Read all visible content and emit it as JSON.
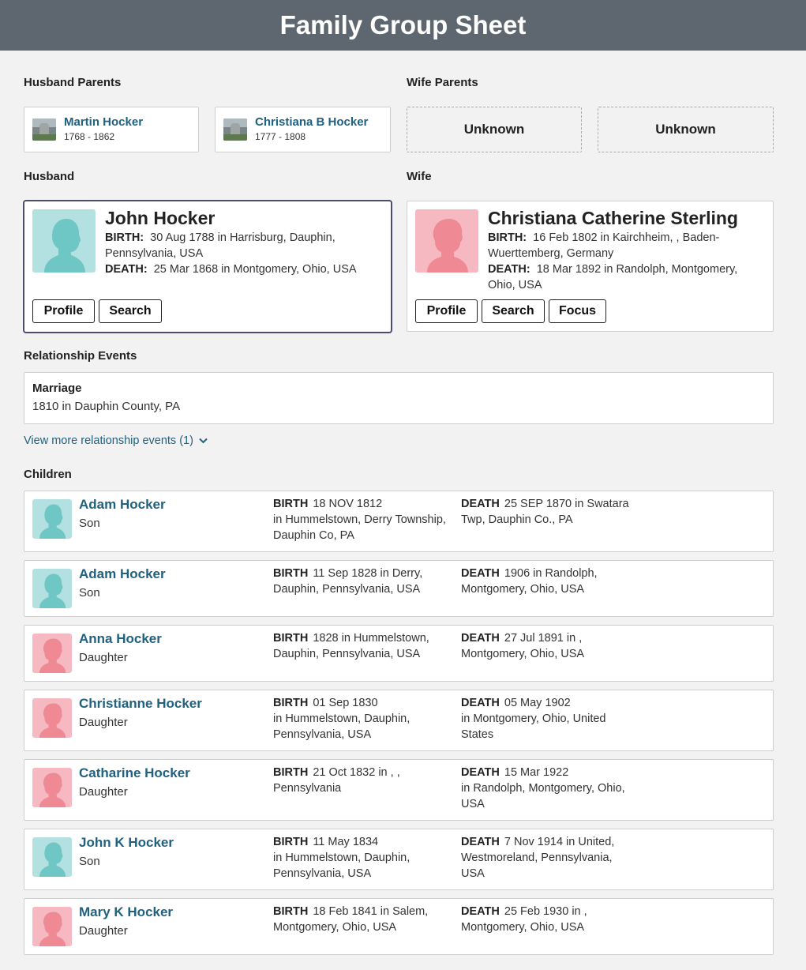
{
  "page": {
    "title": "Family Group Sheet"
  },
  "labels": {
    "husband_parents": "Husband Parents",
    "wife_parents": "Wife Parents",
    "husband": "Husband",
    "wife": "Wife",
    "relationship_events": "Relationship Events",
    "children": "Children",
    "birth": "BIRTH:",
    "death": "DEATH:",
    "birth_short": "BIRTH",
    "death_short": "DEATH"
  },
  "husband_parents": [
    {
      "name": "Martin Hocker",
      "dates": "1768 - 1862",
      "icon": "headstone-photo"
    },
    {
      "name": "Christiana B Hocker",
      "dates": "1777 - 1808",
      "icon": "headstone-photo"
    }
  ],
  "wife_parents": [
    {
      "label": "Unknown"
    },
    {
      "label": "Unknown"
    }
  ],
  "husband": {
    "name": "John Hocker",
    "birth": "30 Aug 1788 in Harrisburg, Dauphin, Pennsylvania, USA",
    "death": "25 Mar 1868 in Montgomery, Ohio, USA",
    "buttons": {
      "profile": "Profile",
      "search": "Search"
    }
  },
  "wife": {
    "name": "Christiana Catherine Sterling",
    "birth": "16 Feb 1802 in Kairchheim, , Baden-Wuerttemberg, Germany",
    "death": "18 Mar 1892 in Randolph, Montgomery, Ohio, USA",
    "buttons": {
      "profile": "Profile",
      "search": "Search",
      "focus": "Focus"
    }
  },
  "relationship_events": {
    "event_type": "Marriage",
    "event_detail": "1810 in Dauphin County, PA",
    "more_link": "View more relationship events (1)"
  },
  "children": [
    {
      "name": "Adam Hocker",
      "relation": "Son",
      "gender": "male",
      "birth": "18 NOV 1812\nin Hummelstown, Derry Township, Dauphin Co, PA",
      "death": "25 SEP 1870  in Swatara Twp, Dauphin Co., PA"
    },
    {
      "name": "Adam Hocker",
      "relation": "Son",
      "gender": "male",
      "birth": "11 Sep 1828  in Derry, Dauphin, Pennsylvania, USA",
      "death": "1906  in Randolph, Montgomery, Ohio, USA"
    },
    {
      "name": "Anna Hocker",
      "relation": "Daughter",
      "gender": "female",
      "birth": "1828  in Hummelstown, Dauphin, Pennsylvania, USA",
      "death": "27 Jul 1891  in , Montgomery, Ohio, USA"
    },
    {
      "name": "Christianne Hocker",
      "relation": "Daughter",
      "gender": "female",
      "birth": "01 Sep 1830\nin Hummelstown, Dauphin, Pennsylvania, USA",
      "death": "05 May 1902\nin Montgomery, Ohio, United States"
    },
    {
      "name": "Catharine Hocker",
      "relation": "Daughter",
      "gender": "female",
      "birth": "21 Oct 1832  in , , Pennsylvania",
      "death": "15 Mar 1922\nin Randolph, Montgomery, Ohio, USA"
    },
    {
      "name": "John K Hocker",
      "relation": "Son",
      "gender": "male",
      "birth": "11 May 1834\nin Hummelstown, Dauphin, Pennsylvania, USA",
      "death": "7 Nov 1914  in United, Westmoreland, Pennsylvania, USA"
    },
    {
      "name": "Mary K Hocker",
      "relation": "Daughter",
      "gender": "female",
      "birth": "18 Feb 1841  in Salem, Montgomery, Ohio, USA",
      "death": "25 Feb 1930  in , Montgomery, Ohio, USA"
    }
  ],
  "colors": {
    "header_bg": "#5e6670",
    "link": "#1f6180",
    "male_avatar": "#b3e0e0",
    "female_avatar": "#f6b9c2",
    "selected_border": "#4c4d6d"
  }
}
